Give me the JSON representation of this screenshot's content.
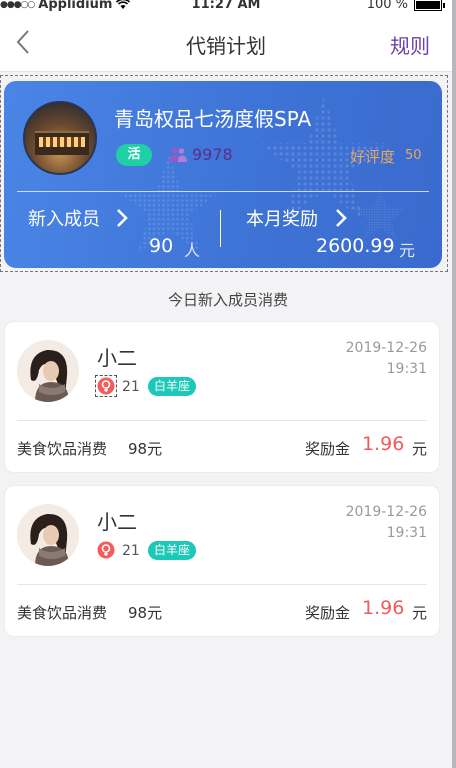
{
  "status_bar": {
    "carrier": "Applidium",
    "time": "11:27 AM",
    "battery": "100 %"
  },
  "nav": {
    "title": "代销计划",
    "rules": "规则"
  },
  "store": {
    "name": "青岛权品七汤度假SPA",
    "tag": "活",
    "popularity": "9978",
    "rating_label": "好评度",
    "rating_value": "50",
    "new_members_label": "新入成员",
    "new_members_value": "90",
    "new_members_unit": "人",
    "monthly_reward_label": "本月奖励",
    "monthly_reward_value": "2600.99",
    "monthly_reward_unit": "元"
  },
  "section_title": "今日新入成员消费",
  "members": [
    {
      "name": "小二",
      "age": "21",
      "zodiac": "白羊座",
      "date": "2019-12-26",
      "time": "19:31",
      "spend_label": "美食饮品消费",
      "spend_amount": "98元",
      "bonus_label": "奖励金",
      "bonus_value": "1.96",
      "bonus_unit": "元"
    },
    {
      "name": "小二",
      "age": "21",
      "zodiac": "白羊座",
      "date": "2019-12-26",
      "time": "19:31",
      "spend_label": "美食饮品消费",
      "spend_amount": "98元",
      "bonus_label": "奖励金",
      "bonus_value": "1.96",
      "bonus_unit": "元"
    }
  ],
  "colors": {
    "accent": "#6a43a6",
    "hero_blue": "#3e74d6",
    "bonus_red": "#f15a5a",
    "teal": "#1cc8b8",
    "rating_orange": "#e8a860"
  },
  "icons": {
    "back": "chevron-left-icon",
    "wifi": "wifi-icon",
    "people": "people-icon",
    "chevron": "chevron-right-icon",
    "gender": "female-icon"
  }
}
